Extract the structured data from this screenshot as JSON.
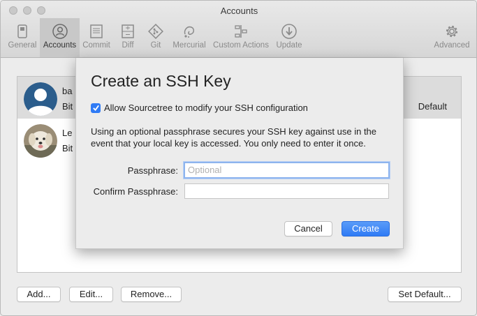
{
  "window": {
    "title": "Accounts"
  },
  "toolbar": {
    "items": [
      {
        "label": "General",
        "icon": "switch-icon"
      },
      {
        "label": "Accounts",
        "icon": "person-icon",
        "active": true
      },
      {
        "label": "Commit",
        "icon": "document-icon"
      },
      {
        "label": "Diff",
        "icon": "diff-icon"
      },
      {
        "label": "Git",
        "icon": "git-icon"
      },
      {
        "label": "Mercurial",
        "icon": "mercurial-icon"
      },
      {
        "label": "Custom Actions",
        "icon": "custom-actions-icon"
      },
      {
        "label": "Update",
        "icon": "download-icon"
      },
      {
        "label": "Advanced",
        "icon": "gear-icon"
      }
    ]
  },
  "accounts": {
    "rows": [
      {
        "name": "ba",
        "host": "Bit",
        "default_label": "Default",
        "avatar": "person-avatar"
      },
      {
        "name": "Le",
        "host": "Bit",
        "avatar": "dog-photo-avatar"
      }
    ],
    "buttons": {
      "add": "Add...",
      "edit": "Edit...",
      "remove": "Remove...",
      "set_default": "Set Default..."
    }
  },
  "sheet": {
    "title": "Create an SSH Key",
    "checkbox_label": "Allow Sourcetree to modify your SSH configuration",
    "checkbox_checked": true,
    "description": "Using an optional passphrase secures your SSH key against use in the event that your local key is accessed. You only need to enter it once.",
    "passphrase_label": "Passphrase:",
    "passphrase_placeholder": "Optional",
    "passphrase_value": "",
    "confirm_label": "Confirm Passphrase:",
    "confirm_value": "",
    "cancel": "Cancel",
    "create": "Create"
  },
  "colors": {
    "accent": "#2f7bf5",
    "selection": "#dcdcdc",
    "avatar_bg": "#2b5d8c"
  }
}
